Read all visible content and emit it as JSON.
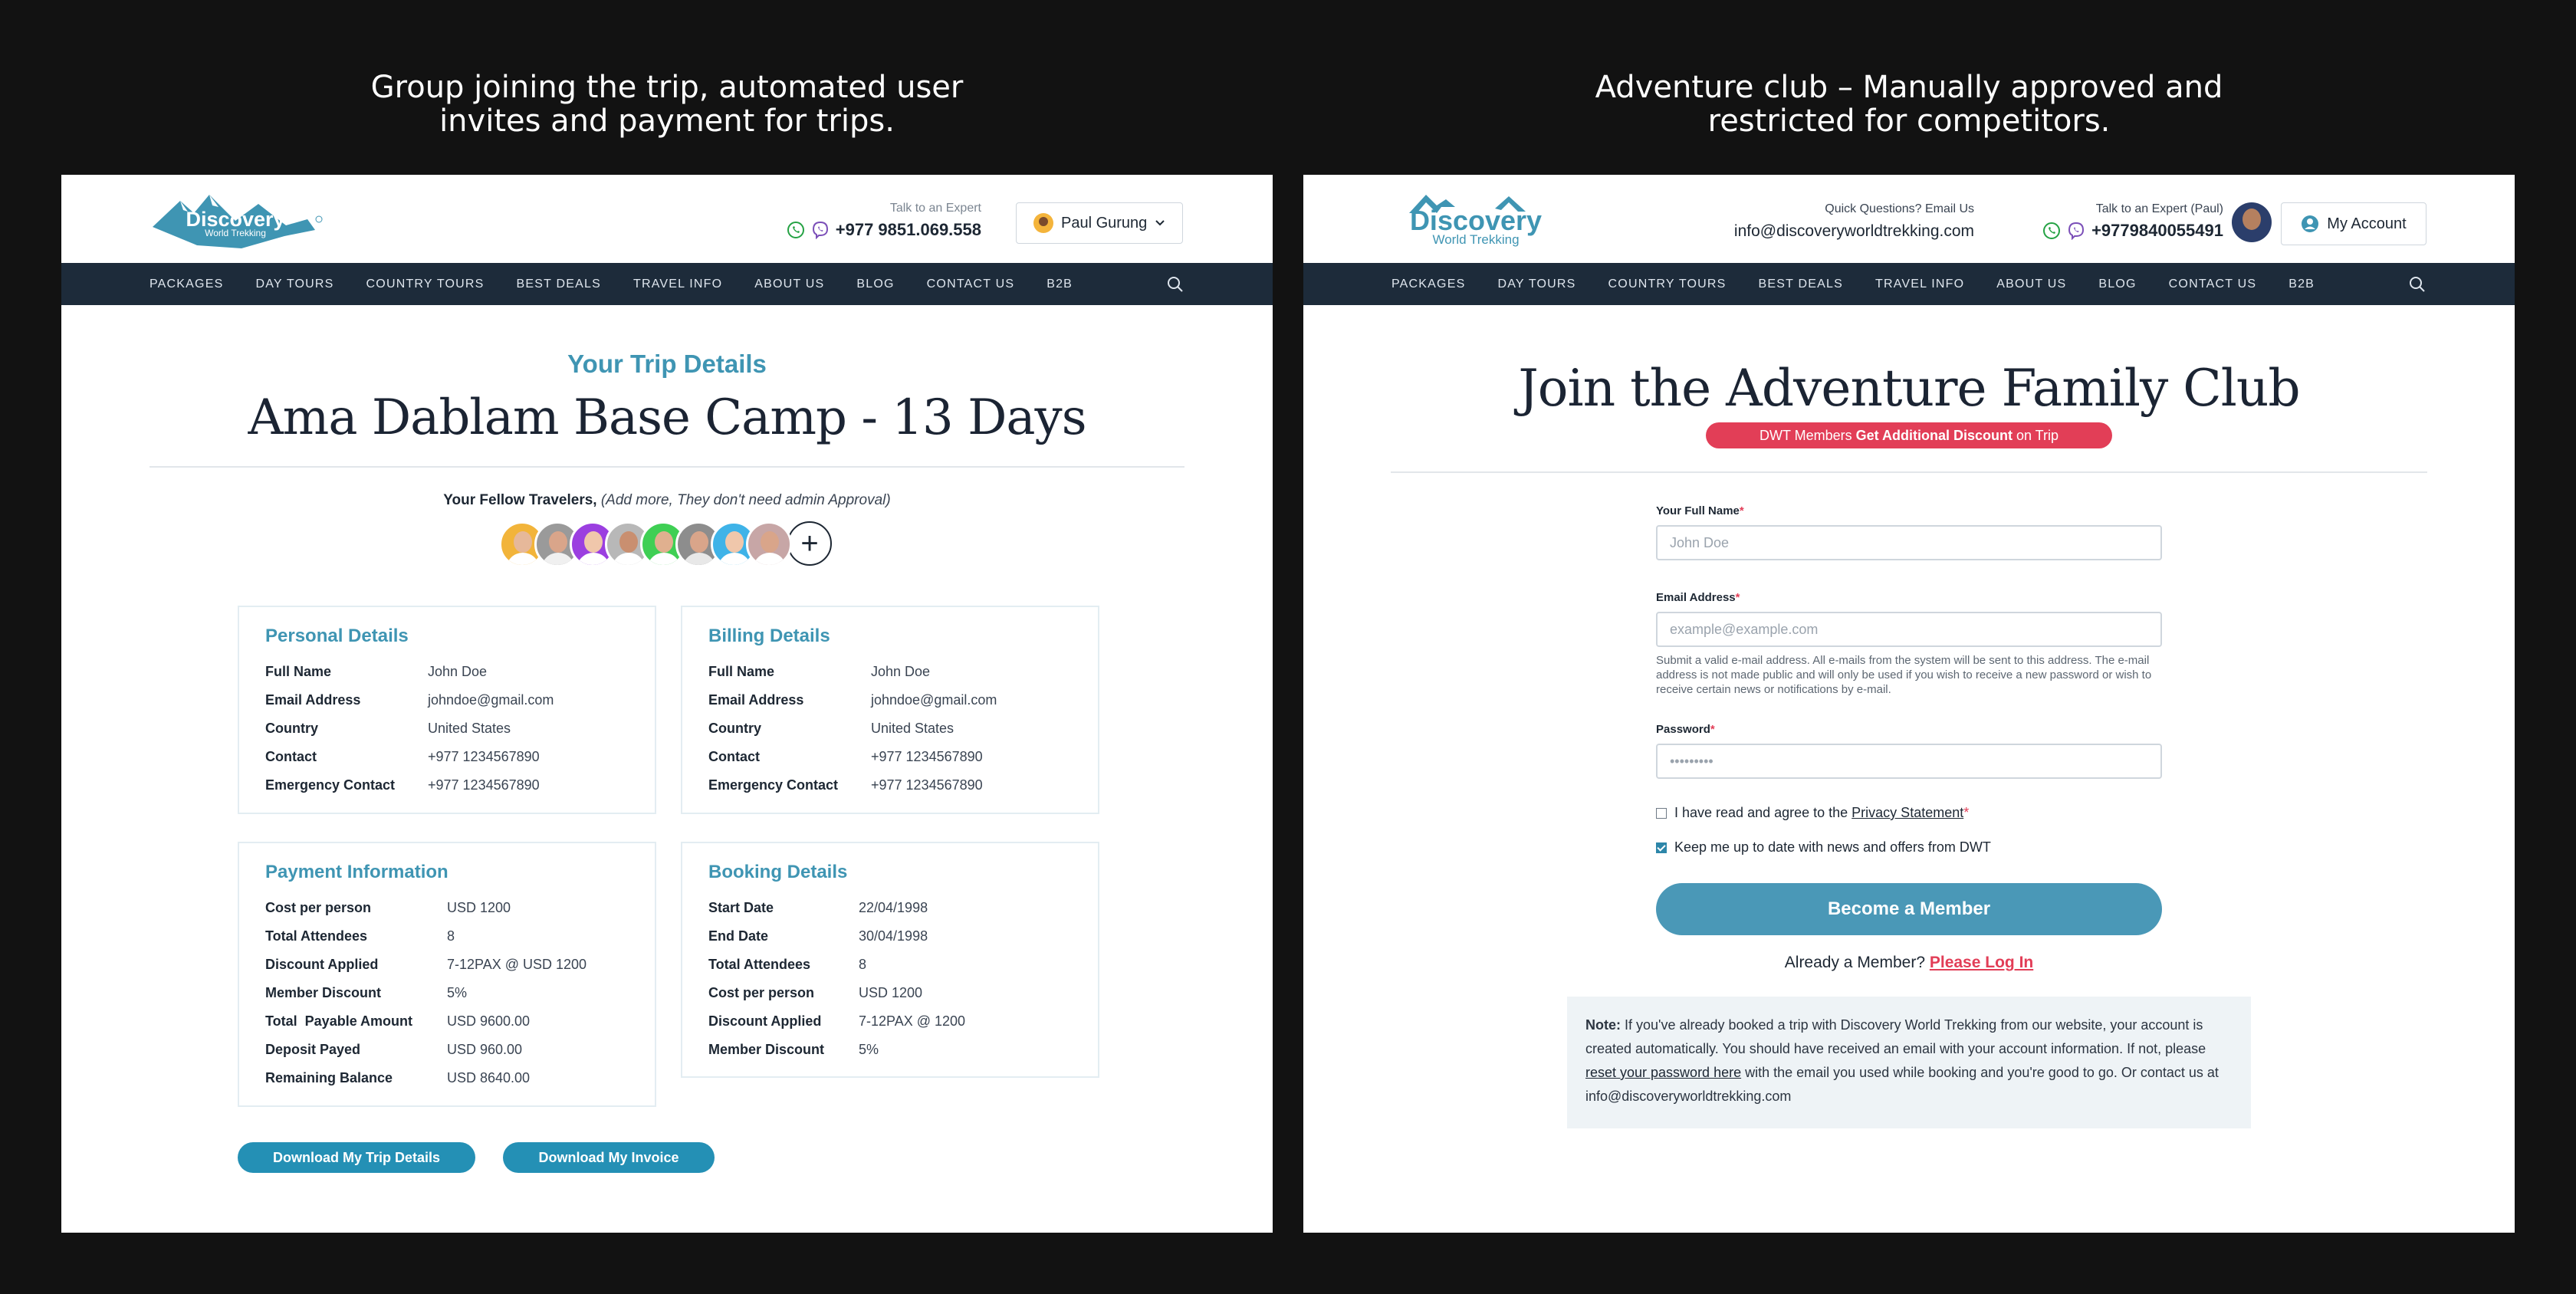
{
  "captions": {
    "left_line1": "Group joining the trip, automated user",
    "left_line2": "invites and payment for trips.",
    "right_line1": "Adventure club – Manually approved and",
    "right_line2": "restricted for competitors."
  },
  "brand": {
    "logo_line1": "Discovery",
    "logo_line2": "World Trekking",
    "accent": "#3f95b3",
    "navy": "#1d2b3a",
    "red": "#e23e57"
  },
  "nav": [
    "PACKAGES",
    "DAY TOURS",
    "COUNTRY TOURS",
    "BEST DEALS",
    "TRAVEL INFO",
    "ABOUT US",
    "BLOG",
    "CONTACT US",
    "B2B"
  ],
  "left": {
    "header": {
      "expert_label": "Talk to an Expert",
      "phone": "+977 9851.069.558",
      "user_name": "Paul Gurung"
    },
    "subtitle": "Your Trip Details",
    "title": "Ama Dablam Base Camp - 13 Days",
    "fellow_bold": "Your Fellow Travelers,",
    "fellow_note": "(Add more, They don't need admin Approval)",
    "add_symbol": "+",
    "personal": {
      "title": "Personal Details",
      "rows": [
        {
          "k": "Full Name",
          "v": "John Doe"
        },
        {
          "k": "Email Address",
          "v": "johndoe@gmail.com"
        },
        {
          "k": "Country",
          "v": "United States"
        },
        {
          "k": "Contact",
          "v": "+977 1234567890"
        },
        {
          "k": "Emergency Contact",
          "v": "+977 1234567890"
        }
      ]
    },
    "billing": {
      "title": "Billing Details",
      "rows": [
        {
          "k": "Full Name",
          "v": "John Doe"
        },
        {
          "k": "Email Address",
          "v": "johndoe@gmail.com"
        },
        {
          "k": "Country",
          "v": "United States"
        },
        {
          "k": "Contact",
          "v": "+977 1234567890"
        },
        {
          "k": "Emergency Contact",
          "v": "+977 1234567890"
        }
      ]
    },
    "payment": {
      "title": "Payment Information",
      "rows": [
        {
          "k": "Cost per person",
          "v": "USD 1200"
        },
        {
          "k": "Total Attendees",
          "v": "8"
        },
        {
          "k": "Discount Applied",
          "v": "7-12PAX @ USD 1200"
        },
        {
          "k": "Member Discount",
          "v": "5%"
        },
        {
          "k": "Total  Payable Amount",
          "v": "USD 9600.00"
        },
        {
          "k": "Deposit Payed",
          "v": "USD 960.00"
        },
        {
          "k": "Remaining Balance",
          "v": "USD 8640.00"
        }
      ]
    },
    "booking": {
      "title": "Booking Details",
      "rows": [
        {
          "k": "Start Date",
          "v": "22/04/1998"
        },
        {
          "k": "End Date",
          "v": "30/04/1998"
        },
        {
          "k": "Total Attendees",
          "v": "8"
        },
        {
          "k": "Cost per person",
          "v": "USD 1200"
        },
        {
          "k": "Discount Applied",
          "v": "7-12PAX @ 1200"
        },
        {
          "k": "Member Discount",
          "v": "5%"
        }
      ]
    },
    "download_trip": "Download My Trip Details",
    "download_invoice": "Download My Invoice"
  },
  "right": {
    "header": {
      "quick_label": "Quick Questions? Email Us",
      "email": "info@discoveryworldtrekking.com",
      "expert_label": "Talk to an Expert (Paul)",
      "phone": "+9779840055491",
      "account": "My Account"
    },
    "title": "Join the Adventure Family Club",
    "badge_pre": "DWT Members ",
    "badge_bold": "Get Additional Discount",
    "badge_post": " on Trip",
    "form": {
      "name_label": "Your Full Name",
      "name_placeholder": "John Doe",
      "email_label": "Email Address",
      "email_placeholder": "example@example.com",
      "email_help": "Submit a valid e-mail address. All e-mails from the system will be sent to this address. The e-mail address is not made public and will only be used if you wish to receive a new password or wish to receive certain news or notifications by e-mail.",
      "password_label": "Password",
      "password_placeholder": "•••••••••",
      "required_mark": "*",
      "agree_pre": "I have read and agree to the ",
      "agree_link": "Privacy Statement",
      "keep_label": "Keep me up to date with news and offers from DWT",
      "submit": "Become a Member",
      "already": "Already a Member? ",
      "login": "Please Log In"
    },
    "note": {
      "bold": "Note:",
      "text1": " If you've already booked a trip with Discovery World Trekking from our website, your account is created automatically. You should have received an email with your account information. If not, please ",
      "link": "reset your password here",
      "text2": " with the email you used while booking and you're good to go. Or contact us at info@discoveryworldtrekking.com"
    }
  }
}
